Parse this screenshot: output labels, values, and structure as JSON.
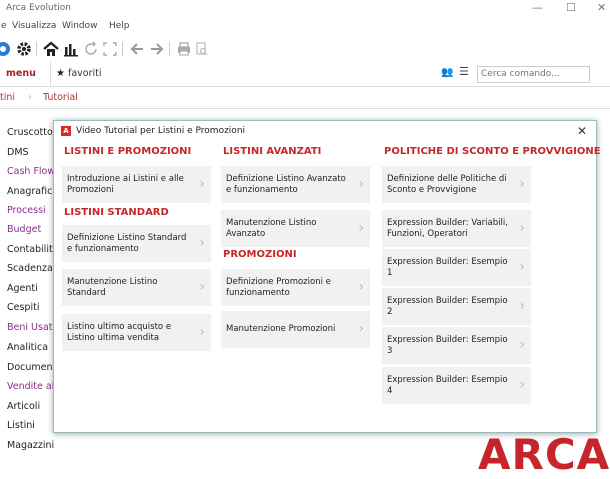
{
  "window": {
    "title": "Arca Evolution",
    "controls": {
      "minimize": "—",
      "maximize": "☐",
      "close": "✕"
    }
  },
  "menubar": [
    "e",
    "Visualizza",
    "Window",
    "Help"
  ],
  "tabs": {
    "menu": "menu",
    "favorites": "favoriti"
  },
  "search": {
    "placeholder": "Cerca comando..."
  },
  "breadcrumb": [
    "tini",
    "Tutorial"
  ],
  "sidebar": {
    "items": [
      {
        "label": "Cruscotto",
        "color": "#222222"
      },
      {
        "label": "DMS",
        "color": "#222222"
      },
      {
        "label": "Cash Flow",
        "color": "#8b2d8b"
      },
      {
        "label": "Anagrafici",
        "color": "#222222"
      },
      {
        "label": "Processi",
        "color": "#8b2d8b"
      },
      {
        "label": "Budget",
        "color": "#8b2d8b"
      },
      {
        "label": "Contabilità",
        "color": "#222222"
      },
      {
        "label": "Scadenzario",
        "color": "#222222"
      },
      {
        "label": "Agenti",
        "color": "#222222"
      },
      {
        "label": "Cespiti",
        "color": "#222222"
      },
      {
        "label": "Beni Usati",
        "color": "#8b2d8b"
      },
      {
        "label": "Analitica",
        "color": "#222222"
      },
      {
        "label": "Documenti",
        "color": "#222222"
      },
      {
        "label": "Vendite al",
        "color": "#8b2d8b"
      },
      {
        "label": "Articoli",
        "color": "#222222"
      },
      {
        "label": "Listini",
        "color": "#222222"
      },
      {
        "label": "Magazzini",
        "color": "#222222"
      }
    ]
  },
  "logo": {
    "text": "ARCA",
    "color": "#c6252d"
  },
  "modal": {
    "title": "Video Tutorial per Listini e Promozioni",
    "app_icon": "A",
    "close": "✕",
    "columns": [
      {
        "sections": [
          {
            "heading": "LISTINI E PROMOZIONI",
            "items": [
              "Introduzione ai Listini e alle Promozioni"
            ]
          },
          {
            "heading": "LISTINI STANDARD",
            "items": [
              "Definizione Listino Standard e funzionamento",
              "Manutenzione Listino Standard",
              "Listino ultimo acquisto e Listino ultima vendita"
            ]
          }
        ]
      },
      {
        "sections": [
          {
            "heading": "LISTINI AVANZATI",
            "items": [
              "Definizione Listino Avanzato e funzionamento",
              "Manutenzione Listino Avanzato"
            ]
          },
          {
            "heading": "PROMOZIONI",
            "items": [
              "Definizione Promozioni e funzionamento",
              "Manutenzione Promozioni"
            ]
          }
        ]
      },
      {
        "sections": [
          {
            "heading": "POLITICHE DI SCONTO E PROVVIGIONE",
            "items": [
              "Definizione delle Politiche di Sconto e Provvigione",
              "Expression Builder: Variabili, Funzioni, Operatori",
              "Expression Builder: Esempio 1",
              "Expression Builder: Esempio 2",
              "Expression Builder: Esempio 3",
              "Expression Builder: Esempio 4"
            ]
          }
        ]
      }
    ]
  }
}
